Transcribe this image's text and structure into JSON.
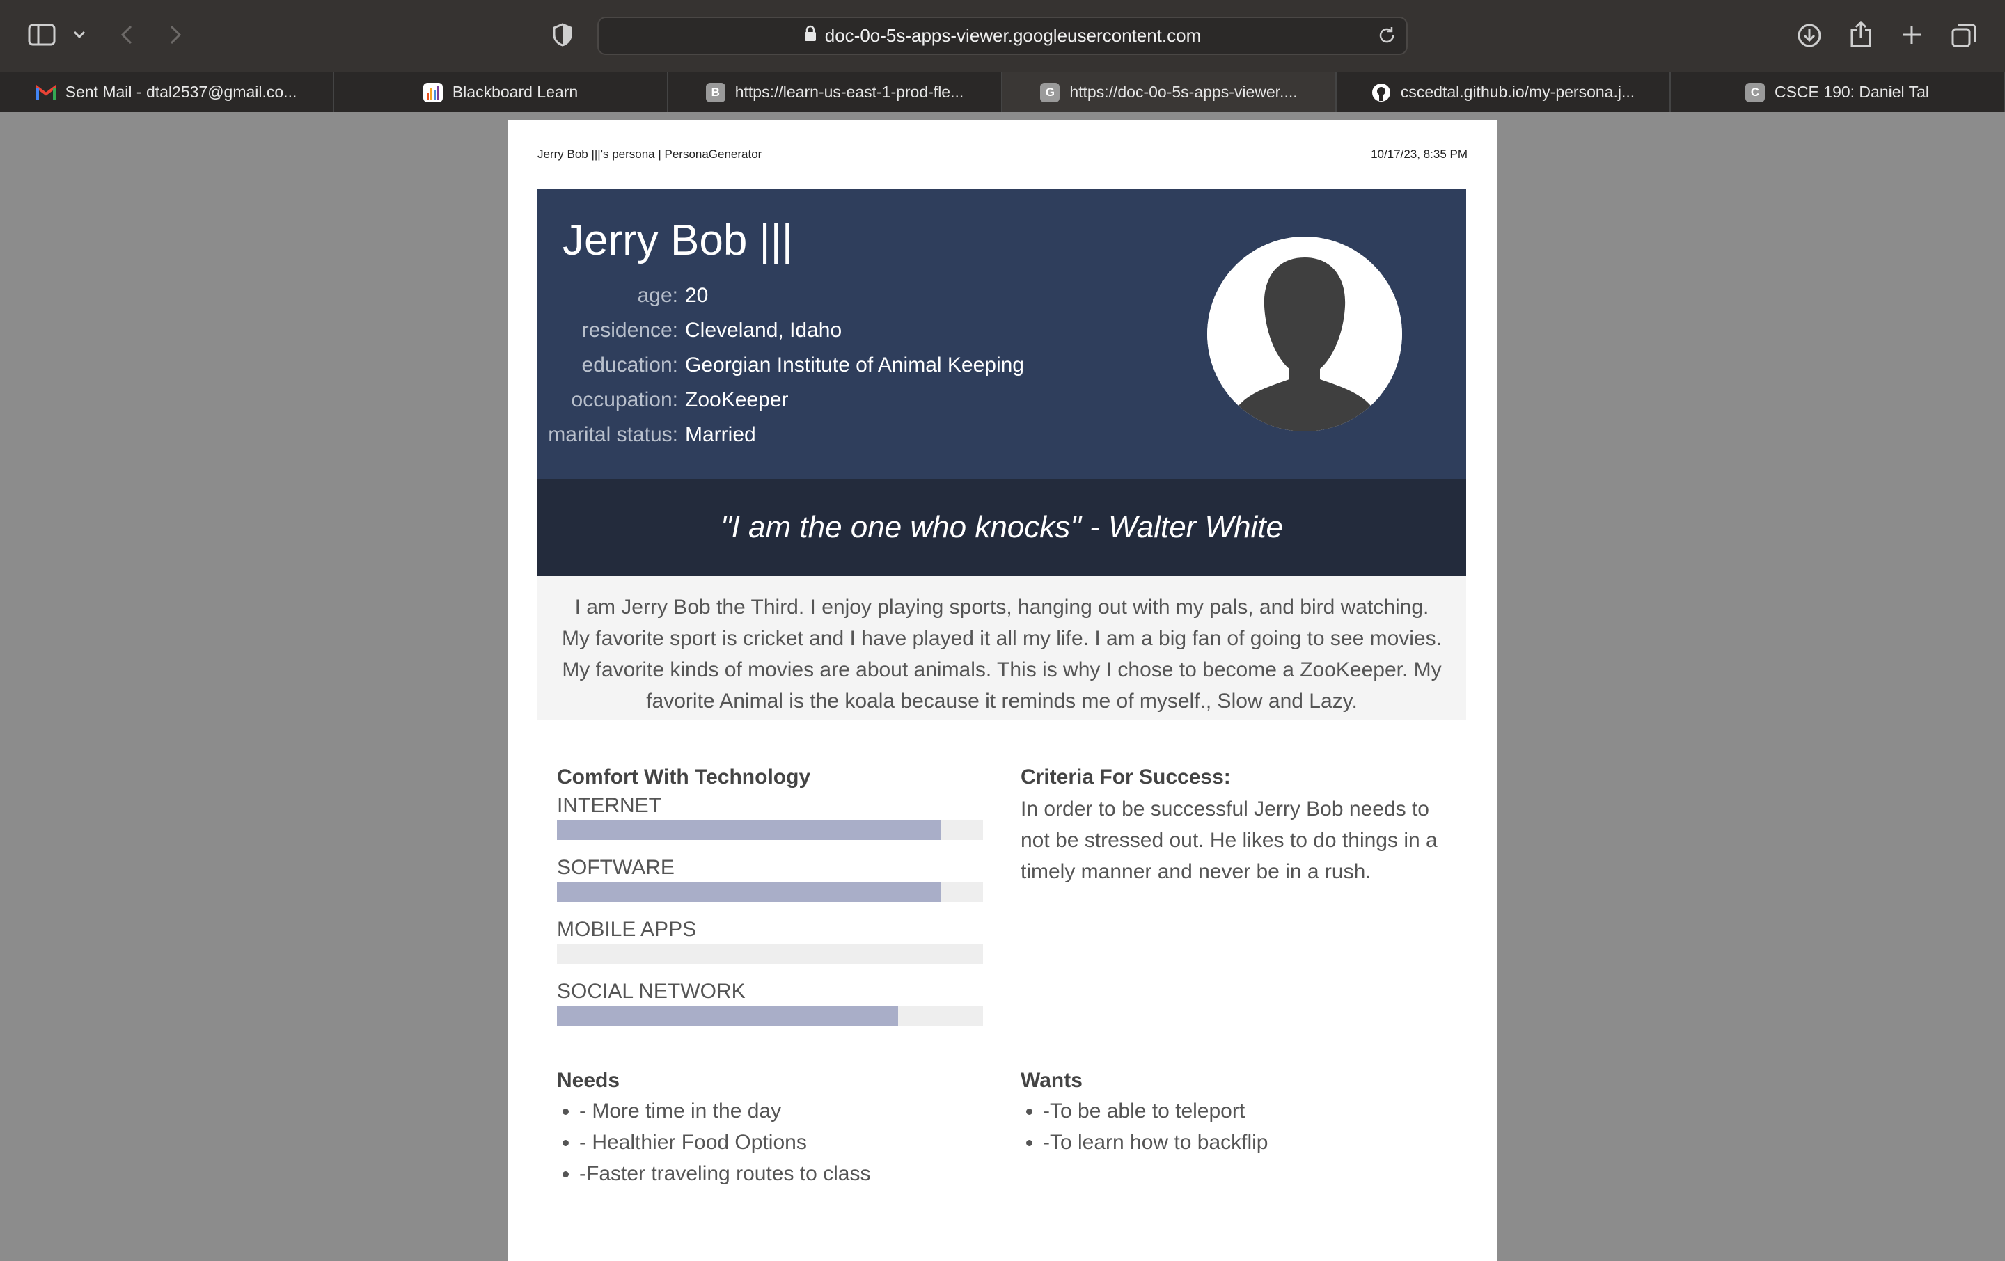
{
  "browser": {
    "url": "doc-0o-5s-apps-viewer.googleusercontent.com",
    "tabs": [
      {
        "label": "Sent Mail - dtal2537@gmail.co...",
        "icon": "gmail-icon",
        "active": false
      },
      {
        "label": "Blackboard Learn",
        "icon": "blackboard-icon",
        "active": false
      },
      {
        "label": "https://learn-us-east-1-prod-fle...",
        "icon": "letter-b-icon",
        "favletter": "B",
        "active": false
      },
      {
        "label": "https://doc-0o-5s-apps-viewer....",
        "icon": "letter-g-icon",
        "favletter": "G",
        "active": true
      },
      {
        "label": "cscedtal.github.io/my-persona.j...",
        "icon": "github-icon",
        "active": false
      },
      {
        "label": "CSCE 190: Daniel Tal",
        "icon": "letter-c-icon",
        "favletter": "C",
        "active": false
      }
    ]
  },
  "print_header": {
    "left": "Jerry Bob |||'s persona | PersonaGenerator",
    "right": "10/17/23, 8:35 PM"
  },
  "persona": {
    "name": "Jerry Bob |||",
    "facts": [
      {
        "label": "age:",
        "value": "20"
      },
      {
        "label": "residence:",
        "value": "Cleveland, Idaho"
      },
      {
        "label": "education:",
        "value": "Georgian Institute of Animal Keeping"
      },
      {
        "label": "occupation:",
        "value": "ZooKeeper"
      },
      {
        "label": "marital status:",
        "value": "Married"
      }
    ],
    "quote": "\"I am the one who knocks\" - Walter White",
    "bio": "I am Jerry Bob the Third. I enjoy playing sports, hanging out with my pals, and bird watching. My fa­vorite sport is cricket and I have played it all my life. I am a big fan of going to see movies. My fa­vorite kinds of movies are about animals. This is why I chose to become a ZooKeeper. My favorite Animal is the koala because it reminds me of myself., Slow and Lazy."
  },
  "technology": {
    "title": "Comfort With Technology",
    "skills": [
      {
        "name": "INTERNET",
        "level": 0.9
      },
      {
        "name": "SOFTWARE",
        "level": 0.9
      },
      {
        "name": "MOBILE APPS",
        "level": 0.0
      },
      {
        "name": "SOCIAL NETWORK",
        "level": 0.8
      }
    ]
  },
  "criteria": {
    "title": "Criteria For Success:",
    "text": "In order to be successful Jerry Bob needs to not be stressed out. He likes to do things in a timely manner and never be in a rush."
  },
  "needs": {
    "title": "Needs",
    "items": [
      "- More time in the day",
      "- Healthier Food Options",
      "-Faster traveling routes to class"
    ]
  },
  "wants": {
    "title": "Wants",
    "items": [
      "-To be able to teleport",
      "-To learn how to backflip"
    ]
  },
  "colors": {
    "hero": "#2f3e5c",
    "quote_band": "#232b3c",
    "bar_fill": "#a9aec8",
    "bar_track": "#eeeeee"
  }
}
